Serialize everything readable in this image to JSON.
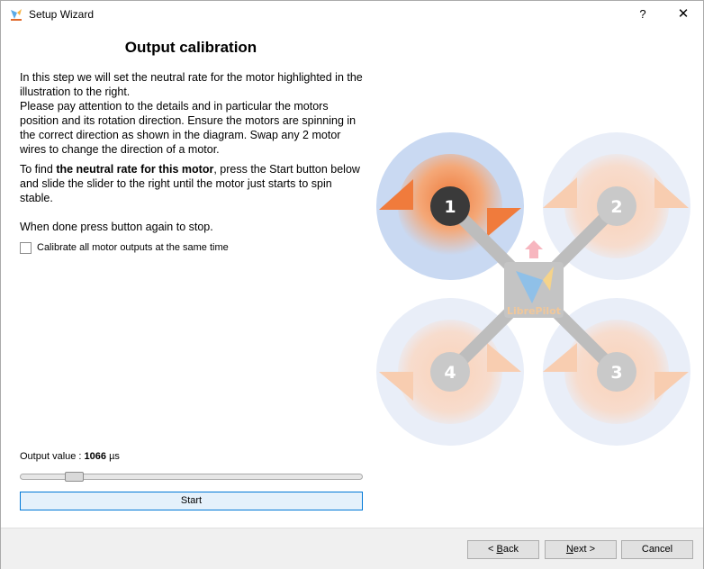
{
  "window": {
    "title": "Setup Wizard",
    "help_label": "?",
    "close_label": "✕"
  },
  "page": {
    "heading": "Output calibration",
    "paragraph1": "In this step we will set the neutral rate for the motor highlighted in the illustration to the right.\nPlease pay attention to the details and in particular the motors position and its rotation direction. Ensure the motors are spinning in the correct direction as shown in the diagram. Swap any 2 motor wires to change the direction of a motor.",
    "paragraph2_prefix": "To find ",
    "paragraph2_bold": "the neutral rate for this motor",
    "paragraph2_suffix": ", press the Start button below and slide the slider to the right until the motor just starts to spin stable.",
    "paragraph3": "When done press button again to stop.",
    "calibrate_all_label": "Calibrate all motor outputs at the same time",
    "calibrate_all_checked": false,
    "output_label": "Output value : ",
    "output_value": "1066",
    "output_unit": " µs",
    "slider_fraction": 0.14,
    "start_label": "Start"
  },
  "diagram": {
    "motors": [
      "1",
      "2",
      "3",
      "4"
    ],
    "highlighted_motor": "1",
    "logo_text": "LibrePilot"
  },
  "footer": {
    "back_mnemonic": "B",
    "back_rest": "ack",
    "back_prefix": "< ",
    "next_mnemonic": "N",
    "next_rest": "ext >",
    "cancel_label": "Cancel"
  },
  "colors": {
    "accent": "#0078d7",
    "highlight_ring": "#c9d9f2",
    "arrow_orange": "#f07b3c",
    "arrow_faded": "#f8cdb0",
    "arm_gray": "#bdbdbd",
    "motor_dark": "#3a3a3a"
  }
}
